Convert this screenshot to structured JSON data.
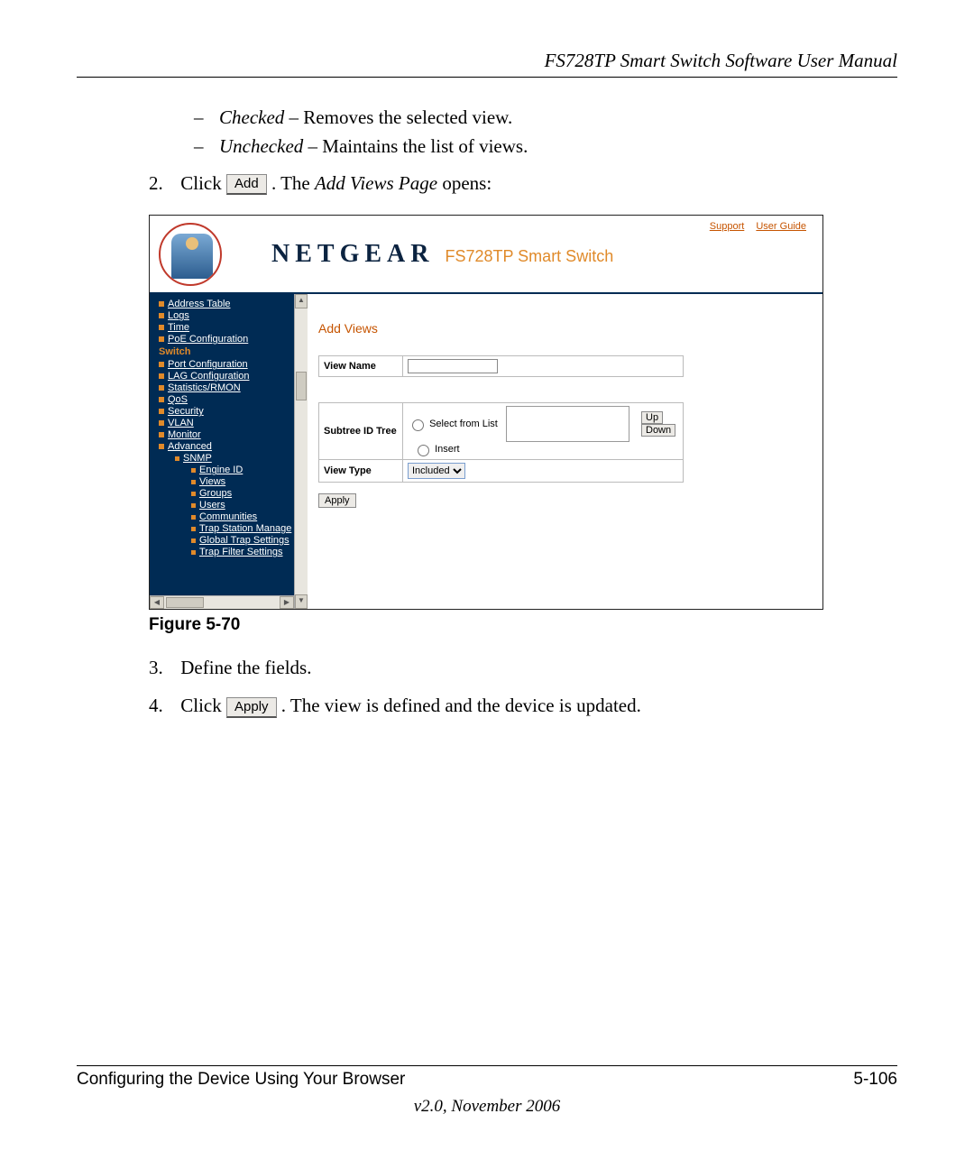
{
  "doc": {
    "header_title": "FS728TP Smart Switch Software User Manual",
    "footer_left": "Configuring the Device Using Your Browser",
    "footer_right": "5-106",
    "version": "v2.0, November 2006",
    "figure_caption": "Figure 5-70"
  },
  "text": {
    "checked_label": "Checked",
    "checked_desc": " – Removes the selected view.",
    "unchecked_label": "Unchecked",
    "unchecked_desc": " – Maintains the list of views.",
    "step2_num": "2.",
    "step2_a": "Click ",
    "step2_btn": "Add",
    "step2_b": ". The ",
    "step2_it": "Add Views Page",
    "step2_c": " opens:",
    "step3_num": "3.",
    "step3": "Define the fields.",
    "step4_num": "4.",
    "step4_a": "Click ",
    "step4_btn": "Apply",
    "step4_b": ". The view is defined and the device is updated."
  },
  "screenshot": {
    "brand": "NETGEAR",
    "product": "FS728TP Smart Switch",
    "top_links": {
      "support": "Support",
      "user_guide": "User Guide"
    },
    "page_title": "Add Views",
    "form": {
      "view_name_label": "View Name",
      "subtree_label": "Subtree ID Tree",
      "select_from_list": "Select from List",
      "insert": "Insert",
      "up": "Up",
      "down": "Down",
      "view_type_label": "View Type",
      "view_type_value": "Included"
    },
    "apply": "Apply",
    "sidebar": {
      "items_top": [
        "Address Table",
        "Logs",
        "Time",
        "PoE Configuration"
      ],
      "category": "Switch",
      "items_mid": [
        "Port Configuration",
        "LAG Configuration",
        "Statistics/RMON",
        "QoS",
        "Security",
        "VLAN",
        "Monitor",
        "Advanced"
      ],
      "sub_parent": "SNMP",
      "sub_items": [
        "Engine ID",
        "Views",
        "Groups",
        "Users",
        "Communities",
        "Trap Station Manage",
        "Global Trap Settings",
        "Trap Filter Settings"
      ]
    }
  }
}
